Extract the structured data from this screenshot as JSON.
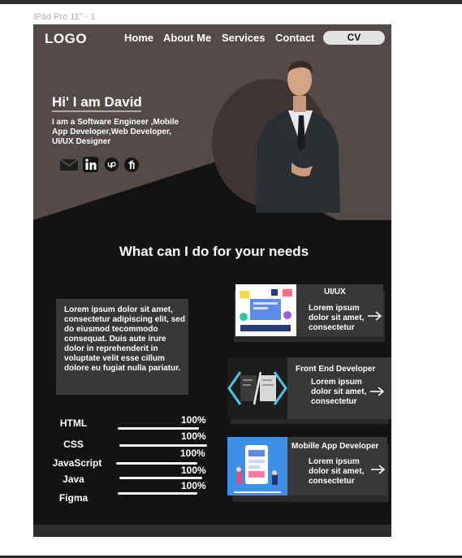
{
  "frame_label": "iPad Pro 11\" - 1",
  "header": {
    "logo": "LOGO",
    "nav": [
      "Home",
      "About Me",
      "Services",
      "Contact"
    ],
    "cv_button": "CV"
  },
  "hero": {
    "greeting": "Hi' I am David",
    "intro": "I am a Software Engineer ,Mobile App Developer,Web Developer, UI/UX Designer",
    "social_icons": [
      "mail-icon",
      "linkedin-icon",
      "upwork-icon",
      "fiverr-icon"
    ]
  },
  "services": {
    "title": "What can I do for your needs",
    "about_text": "Lorem ipsum dolor sit amet, consectetur adipiscing elit, sed do eiusmod tecommodo consequat. Duis aute irure dolor in reprehenderit in voluptate velit esse cillum dolore eu fugiat nulla pariatur.",
    "cards": [
      {
        "title": "UI/UX",
        "description": "Lorem ipsum dolor sit amet, consectetur",
        "arrow": "arrow-right-icon"
      },
      {
        "title": "Front End Developer",
        "description": "Lorem ipsum dolor sit amet, consectetur",
        "arrow": "arrow-right-icon"
      },
      {
        "title": "Mobille App Developer",
        "description": "Lorem ipsum dolor sit amet, consectetur",
        "arrow": "arrow-right-icon"
      }
    ]
  },
  "skills": [
    {
      "name": "HTML",
      "percent": "100%"
    },
    {
      "name": "CSS",
      "percent": "100%"
    },
    {
      "name": "JavaScript",
      "percent": "100%"
    },
    {
      "name": "Java",
      "percent": "100%"
    },
    {
      "name": "Figma",
      "percent": "100%"
    }
  ],
  "colors": {
    "hero_background": "#534a49",
    "page_background": "#131313",
    "card_background": "#383838",
    "cv_button": "#e2e2e2"
  }
}
